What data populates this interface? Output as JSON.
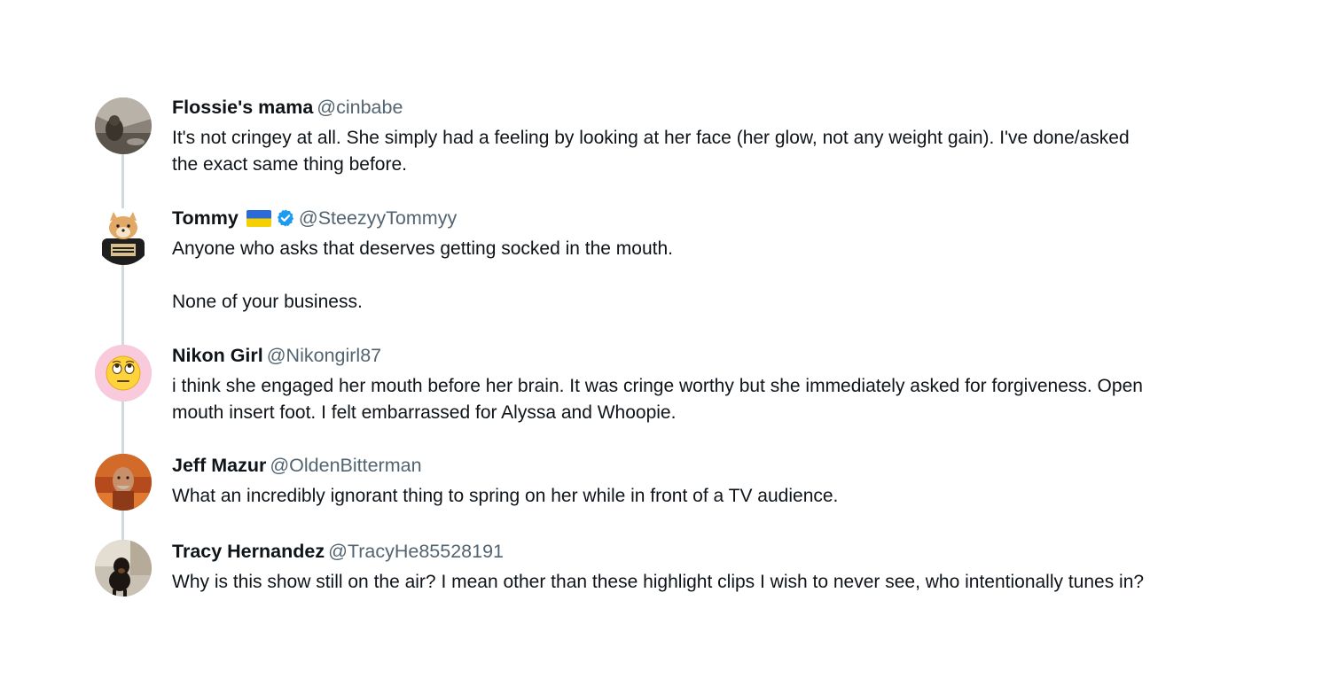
{
  "thread": {
    "posts": [
      {
        "name": "Flossie's mama",
        "handle": "@cinbabe",
        "text": "It's not cringey at all. She simply had a feeling by looking at her face (her glow, not any weight gain). I've done/asked\nthe exact same thing before."
      },
      {
        "name": "Tommy",
        "handle": "@SteezyyTommyy",
        "text": "Anyone who asks that deserves getting socked in the mouth.\n\nNone of your business."
      },
      {
        "name": "Nikon Girl",
        "handle": "@Nikongirl87",
        "text": "i think she engaged her mouth before her brain. It was cringe worthy but she immediately asked for forgiveness. Open\nmouth insert foot. I felt embarrassed for Alyssa and Whoopie."
      },
      {
        "name": "Jeff Mazur",
        "handle": "@OldenBitterman",
        "text": "What an incredibly ignorant thing to spring on her while in front of a TV audience."
      },
      {
        "name": "Tracy Hernandez",
        "handle": "@TracyHe85528191",
        "text": "Why is this show still on the air? I mean other than these highlight clips I wish to never see, who intentionally tunes in?"
      }
    ]
  },
  "colors": {
    "name": "#0f1419",
    "handle": "#536471",
    "thread_line": "#cfd9de",
    "verified": "#1d9bf0",
    "flag_blue": "#2a6ad9",
    "flag_yellow": "#f5d000"
  },
  "icons": {
    "flag": "ukraine-flag-icon",
    "verified": "verified-badge-icon"
  }
}
